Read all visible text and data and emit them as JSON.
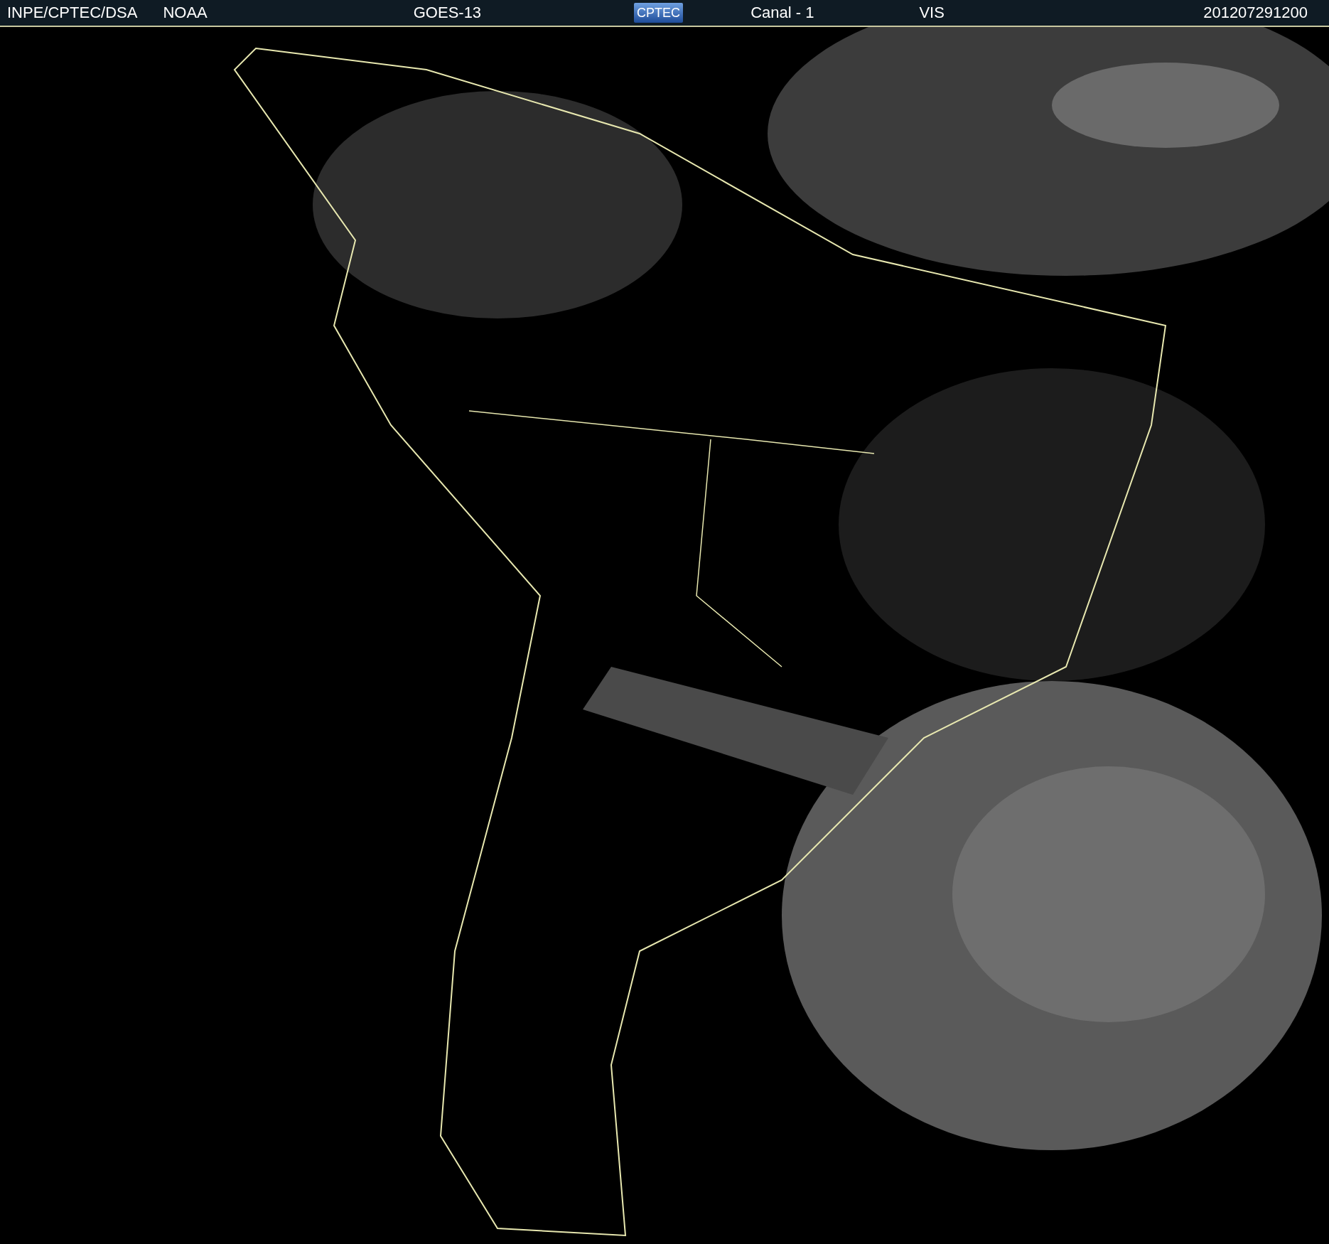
{
  "header": {
    "source": "INPE/CPTEC/DSA",
    "agency": "NOAA",
    "satellite": "GOES-13",
    "logo": "CPTEC",
    "channel": "Canal - 1",
    "band": "VIS",
    "timestamp": "201207291200"
  }
}
